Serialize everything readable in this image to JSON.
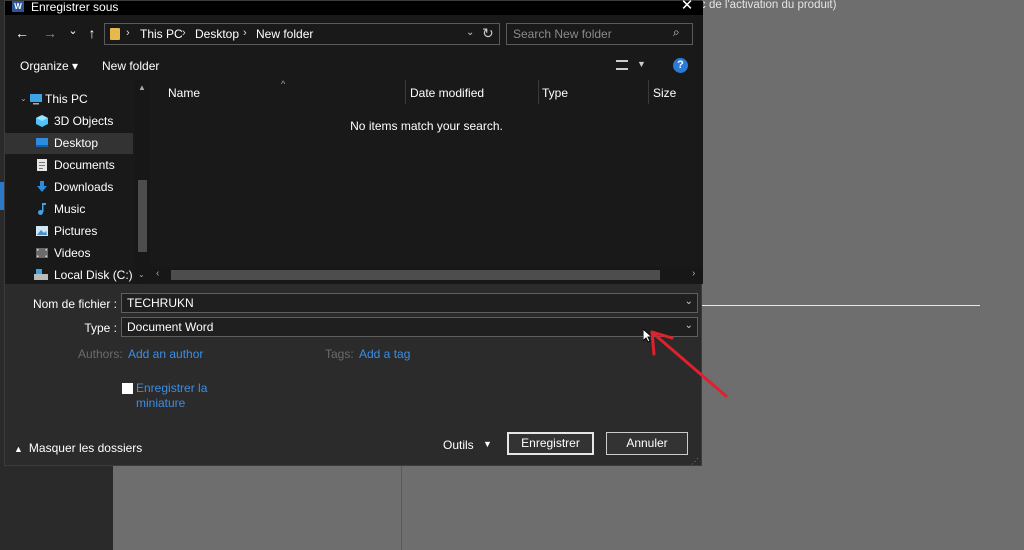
{
  "window": {
    "title": "Enregistrer sous",
    "app_icon": "W"
  },
  "background": {
    "title_fragment": "c de l'activation du produit)"
  },
  "nav": {
    "back_icon": "←",
    "forward_icon": "→",
    "recent_icon": "⌄",
    "up_icon": "↑",
    "breadcrumb": [
      "This PC",
      "Desktop",
      "New folder"
    ],
    "separator": "›",
    "dropdown_icon": "⌄",
    "refresh_icon": "↻"
  },
  "search": {
    "placeholder": "Search New folder",
    "icon": "⌕"
  },
  "toolbar": {
    "organize": "Organize ▾",
    "new_folder": "New folder",
    "help": "?"
  },
  "sidebar": {
    "items": [
      {
        "label": "This PC",
        "icon": "computer-icon"
      },
      {
        "label": "3D Objects",
        "icon": "cube-icon"
      },
      {
        "label": "Desktop",
        "icon": "desktop-icon",
        "selected": true
      },
      {
        "label": "Documents",
        "icon": "documents-icon"
      },
      {
        "label": "Downloads",
        "icon": "download-icon"
      },
      {
        "label": "Music",
        "icon": "music-icon"
      },
      {
        "label": "Pictures",
        "icon": "pictures-icon"
      },
      {
        "label": "Videos",
        "icon": "videos-icon"
      },
      {
        "label": "Local Disk (C:)",
        "icon": "disk-icon"
      }
    ]
  },
  "files": {
    "columns": [
      "Name",
      "Date modified",
      "Type",
      "Size"
    ],
    "empty_message": "No items match your search."
  },
  "form": {
    "filename_label": "Nom de fichier :",
    "filename_value": "TECHRUKN",
    "type_label": "Type :",
    "type_value": "Document Word",
    "authors_label": "Authors:",
    "authors_link": "Add an author",
    "tags_label": "Tags:",
    "tags_link": "Add a tag",
    "thumbnail_label": "Enregistrer la miniature",
    "thumbnail_checked": false
  },
  "footer": {
    "hide_folders": "Masquer les dossiers",
    "tools": "Outils",
    "save": "Enregistrer",
    "cancel": "Annuler"
  },
  "colors": {
    "accent": "#2b7bd6",
    "link": "#3a8ee6",
    "annotation": "#e0202c"
  }
}
